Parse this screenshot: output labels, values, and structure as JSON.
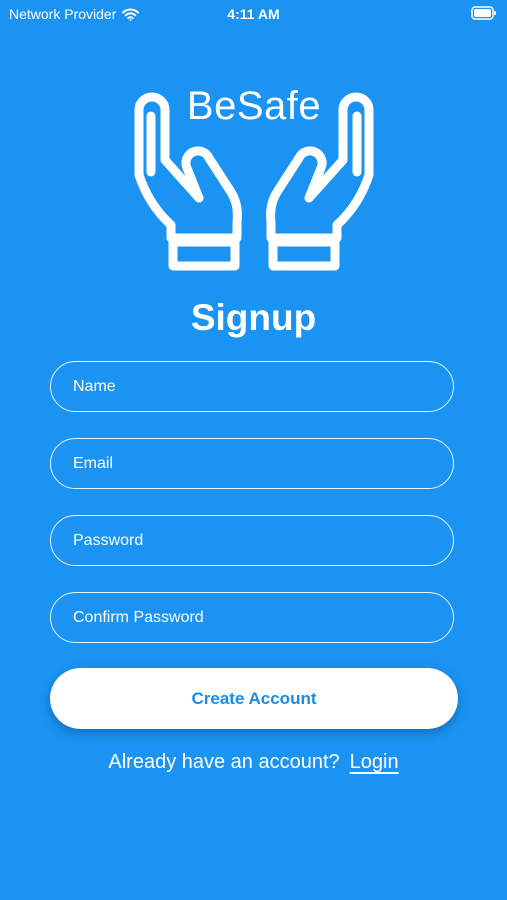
{
  "status_bar": {
    "carrier": "Network Provider",
    "time": "4:11 AM"
  },
  "logo": {
    "text": "BeSafe"
  },
  "title": "Signup",
  "form": {
    "name_placeholder": "Name",
    "email_placeholder": "Email",
    "password_placeholder": "Password",
    "confirm_password_placeholder": "Confirm Password",
    "submit_label": "Create Account"
  },
  "login_prompt": {
    "text": "Already have an account?",
    "link_label": "Login"
  },
  "colors": {
    "background": "#1B93F2",
    "button_text": "#1B8BE4",
    "foreground": "#FFFFFF"
  }
}
